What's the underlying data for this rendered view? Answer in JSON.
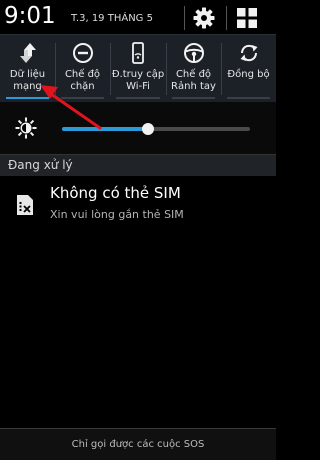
{
  "status": {
    "time": "9:01",
    "date": "T.3, 19 THÁNG 5"
  },
  "icons": {
    "settings": "gear-icon",
    "grid": "grid-view-icon",
    "brightness": "brightness-icon",
    "sim": "sim-card-icon"
  },
  "quick_settings": [
    {
      "label": "Dữ liệu mạng",
      "icon": "data-transfer-icon",
      "active": true
    },
    {
      "label": "Chế độ chặn",
      "icon": "block-icon",
      "active": false
    },
    {
      "label": "Đ.truy cập Wi-Fi",
      "icon": "wifi-hotspot-icon",
      "active": false
    },
    {
      "label": "Chế độ Rảnh tay",
      "icon": "steering-wheel-icon",
      "active": false
    },
    {
      "label": "Đồng bộ",
      "icon": "sync-icon",
      "active": false
    }
  ],
  "brightness": {
    "level": 0.46
  },
  "section": {
    "title": "Đang xử lý"
  },
  "notification": {
    "title": "Không có thẻ SIM",
    "text": "Xin vui lòng gắn thẻ SIM"
  },
  "footer": {
    "text": "Chỉ gọi được các cuộc SOS"
  },
  "colors": {
    "accent": "#2b9ad6",
    "annotation": "#e0141e"
  }
}
